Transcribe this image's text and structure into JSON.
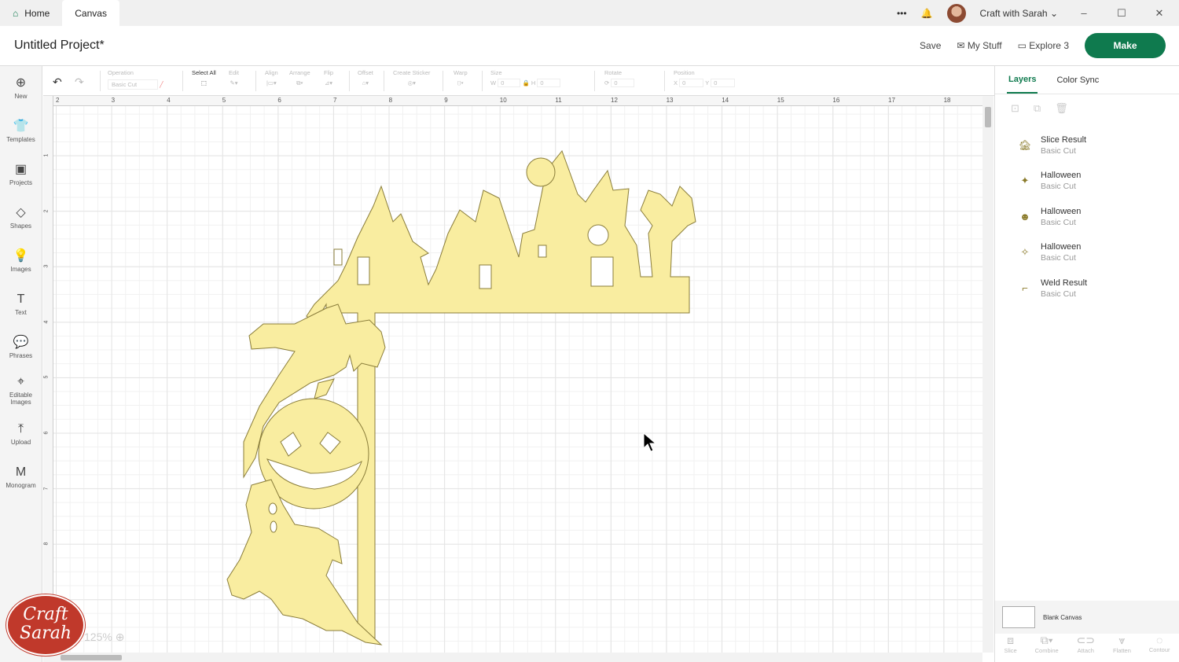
{
  "titlebar": {
    "tabs": [
      {
        "label": "Home"
      },
      {
        "label": "Canvas"
      }
    ],
    "more": "•••",
    "user": "Craft with Sarah",
    "window": [
      "–",
      "☐",
      "✕"
    ]
  },
  "header": {
    "project": "Untitled Project*",
    "save": "Save",
    "my_stuff": "My Stuff",
    "machine": "Explore 3",
    "make": "Make"
  },
  "sidebar": [
    {
      "label": "New",
      "icon": "⊕"
    },
    {
      "label": "Templates",
      "icon": "👕"
    },
    {
      "label": "Projects",
      "icon": "▣"
    },
    {
      "label": "Shapes",
      "icon": "◇"
    },
    {
      "label": "Images",
      "icon": "💡"
    },
    {
      "label": "Text",
      "icon": "T"
    },
    {
      "label": "Phrases",
      "icon": "💬"
    },
    {
      "label": "Editable Images",
      "icon": "⌖"
    },
    {
      "label": "Upload",
      "icon": "⤒"
    },
    {
      "label": "Monogram",
      "icon": "M"
    }
  ],
  "toolbar": {
    "operation": "Operation",
    "operation_value": "Basic Cut",
    "select_all": "Select All",
    "edit": "Edit",
    "align": "Align",
    "arrange": "Arrange",
    "flip": "Flip",
    "offset": "Offset",
    "create_sticker": "Create Sticker",
    "warp": "Warp",
    "size": "Size",
    "w": "W",
    "h": "H",
    "size_w": "0",
    "size_h": "0",
    "rotate": "Rotate",
    "rotate_value": "0",
    "position": "Position",
    "x": "X",
    "y": "Y",
    "pos_x": "0",
    "pos_y": "0"
  },
  "ruler": {
    "top": [
      "2",
      "3",
      "4",
      "5",
      "6",
      "7",
      "8",
      "9",
      "10",
      "11",
      "12",
      "13",
      "14",
      "15",
      "16",
      "17",
      "18"
    ],
    "left": [
      "1",
      "2",
      "3",
      "4",
      "5",
      "6",
      "7",
      "8"
    ]
  },
  "panel": {
    "tabs": [
      "Layers",
      "Color Sync"
    ],
    "layers": [
      {
        "name": "Slice Result",
        "type": "Basic Cut",
        "icon": "🏚"
      },
      {
        "name": "Halloween",
        "type": "Basic Cut",
        "icon": "✦"
      },
      {
        "name": "Halloween",
        "type": "Basic Cut",
        "icon": "☻"
      },
      {
        "name": "Halloween",
        "type": "Basic Cut",
        "icon": "✧"
      },
      {
        "name": "Weld Result",
        "type": "Basic Cut",
        "icon": "⌐"
      }
    ],
    "blank_canvas": "Blank Canvas",
    "actions": [
      "Slice",
      "Combine",
      "Attach",
      "Flatten",
      "Contour"
    ]
  },
  "zoom": "125%",
  "logo": "Craft with Sarah",
  "colors": {
    "accent": "#0f7a4e",
    "artwork": "#f9eda0"
  }
}
